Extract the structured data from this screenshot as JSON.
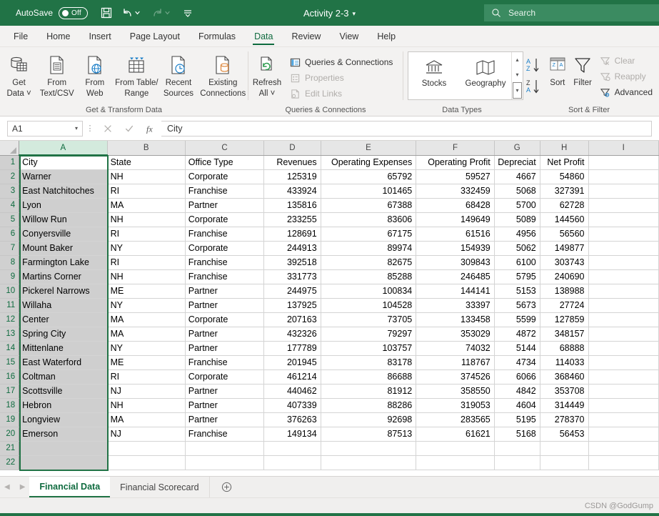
{
  "titlebar": {
    "autosave_label": "AutoSave",
    "autosave_state": "Off",
    "save_icon": "save-icon",
    "undo_icon": "undo-icon",
    "redo_icon": "redo-icon",
    "customize_icon": "customize-quick-access-icon",
    "document_title": "Activity 2-3",
    "title_caret": "▾",
    "search_icon": "search-icon",
    "search_placeholder": "Search",
    "bg_color": "#217346"
  },
  "ribbon_tabs": [
    {
      "label": "File",
      "active": false
    },
    {
      "label": "Home",
      "active": false
    },
    {
      "label": "Insert",
      "active": false
    },
    {
      "label": "Page Layout",
      "active": false
    },
    {
      "label": "Formulas",
      "active": false
    },
    {
      "label": "Data",
      "active": true
    },
    {
      "label": "Review",
      "active": false
    },
    {
      "label": "View",
      "active": false
    },
    {
      "label": "Help",
      "active": false
    }
  ],
  "ribbon": {
    "groups": [
      {
        "title": "Get & Transform Data",
        "buttons": [
          {
            "label": "Get\nData ˅",
            "line1": "Get",
            "line2": "Data ˅",
            "icon": "get-data-icon"
          },
          {
            "label": "From\nText/CSV",
            "line1": "From",
            "line2": "Text/CSV",
            "icon": "from-text-csv-icon"
          },
          {
            "label": "From\nWeb",
            "line1": "From",
            "line2": "Web",
            "icon": "from-web-icon"
          },
          {
            "label": "From Table/\nRange",
            "line1": "From Table/",
            "line2": "Range",
            "icon": "from-table-range-icon"
          },
          {
            "label": "Recent\nSources",
            "line1": "Recent",
            "line2": "Sources",
            "icon": "recent-sources-icon"
          },
          {
            "label": "Existing\nConnections",
            "line1": "Existing",
            "line2": "Connections",
            "icon": "existing-connections-icon"
          }
        ]
      },
      {
        "title": "Queries & Connections",
        "refresh": {
          "line1": "Refresh",
          "line2": "All ˅",
          "icon": "refresh-all-icon"
        },
        "items": [
          {
            "label": "Queries & Connections",
            "icon": "queries-connections-icon",
            "disabled": false
          },
          {
            "label": "Properties",
            "icon": "properties-icon",
            "disabled": true
          },
          {
            "label": "Edit Links",
            "icon": "edit-links-icon",
            "disabled": true
          }
        ]
      },
      {
        "title": "Data Types",
        "items": [
          {
            "label": "Stocks",
            "icon": "stocks-icon"
          },
          {
            "label": "Geography",
            "icon": "geography-icon"
          }
        ],
        "scroll_up": "▴",
        "scroll_down": "▾",
        "scroll_more": "▾"
      },
      {
        "title": "Sort & Filter",
        "sort_asc_icon": "sort-a-to-z-icon",
        "sort_desc_icon": "sort-z-to-a-icon",
        "sort": {
          "label": "Sort",
          "icon": "sort-icon"
        },
        "filter": {
          "label": "Filter",
          "icon": "filter-icon"
        },
        "items": [
          {
            "label": "Clear",
            "icon": "clear-filter-icon",
            "disabled": true
          },
          {
            "label": "Reapply",
            "icon": "reapply-filter-icon",
            "disabled": true
          },
          {
            "label": "Advanced",
            "icon": "advanced-filter-icon",
            "disabled": false
          }
        ]
      }
    ]
  },
  "formula_bar": {
    "name_box": "A1",
    "name_box_caret": "▾",
    "cancel_icon": "cancel-icon",
    "enter_icon": "confirm-check-icon",
    "function_icon": "insert-function-icon",
    "formula_value": "City"
  },
  "grid": {
    "columns": [
      {
        "letter": "A",
        "width": 124,
        "selected": true
      },
      {
        "letter": "B",
        "width": 112,
        "selected": false
      },
      {
        "letter": "C",
        "width": 112,
        "selected": false
      },
      {
        "letter": "D",
        "width": 80,
        "selected": false
      },
      {
        "letter": "E",
        "width": 134,
        "selected": false
      },
      {
        "letter": "F",
        "width": 110,
        "selected": false
      },
      {
        "letter": "G",
        "width": 64,
        "selected": false
      },
      {
        "letter": "H",
        "width": 68,
        "selected": false
      },
      {
        "letter": "I",
        "width": 92,
        "selected": false
      }
    ],
    "headers": [
      "City",
      "State",
      "Office Type",
      "Revenues",
      "Operating Expenses",
      "Operating Profit",
      "Depreciat",
      "Net Profit",
      ""
    ],
    "rows": [
      {
        "n": 1,
        "cells": [
          "City",
          "State",
          "Office Type",
          "Revenues",
          "Operating Expenses",
          "Operating Profit",
          "Depreciat",
          "Net Profit",
          ""
        ]
      },
      {
        "n": 2,
        "cells": [
          "Warner",
          "NH",
          "Corporate",
          "125319",
          "65792",
          "59527",
          "4667",
          "54860",
          ""
        ]
      },
      {
        "n": 3,
        "cells": [
          "East Natchitoches",
          "RI",
          "Franchise",
          "433924",
          "101465",
          "332459",
          "5068",
          "327391",
          ""
        ]
      },
      {
        "n": 4,
        "cells": [
          "Lyon",
          "MA",
          "Partner",
          "135816",
          "67388",
          "68428",
          "5700",
          "62728",
          ""
        ]
      },
      {
        "n": 5,
        "cells": [
          "Willow Run",
          "NH",
          "Corporate",
          "233255",
          "83606",
          "149649",
          "5089",
          "144560",
          ""
        ]
      },
      {
        "n": 6,
        "cells": [
          "Conyersville",
          "RI",
          "Franchise",
          "128691",
          "67175",
          "61516",
          "4956",
          "56560",
          ""
        ]
      },
      {
        "n": 7,
        "cells": [
          "Mount Baker",
          "NY",
          "Corporate",
          "244913",
          "89974",
          "154939",
          "5062",
          "149877",
          ""
        ]
      },
      {
        "n": 8,
        "cells": [
          "Farmington Lake",
          "RI",
          "Franchise",
          "392518",
          "82675",
          "309843",
          "6100",
          "303743",
          ""
        ]
      },
      {
        "n": 9,
        "cells": [
          "Martins Corner",
          "NH",
          "Franchise",
          "331773",
          "85288",
          "246485",
          "5795",
          "240690",
          ""
        ]
      },
      {
        "n": 10,
        "cells": [
          "Pickerel Narrows",
          "ME",
          "Partner",
          "244975",
          "100834",
          "144141",
          "5153",
          "138988",
          ""
        ]
      },
      {
        "n": 11,
        "cells": [
          "Willaha",
          "NY",
          "Partner",
          "137925",
          "104528",
          "33397",
          "5673",
          "27724",
          ""
        ]
      },
      {
        "n": 12,
        "cells": [
          "Center",
          "MA",
          "Corporate",
          "207163",
          "73705",
          "133458",
          "5599",
          "127859",
          ""
        ]
      },
      {
        "n": 13,
        "cells": [
          "Spring City",
          "MA",
          "Partner",
          "432326",
          "79297",
          "353029",
          "4872",
          "348157",
          ""
        ]
      },
      {
        "n": 14,
        "cells": [
          "Mittenlane",
          "NY",
          "Partner",
          "177789",
          "103757",
          "74032",
          "5144",
          "68888",
          ""
        ]
      },
      {
        "n": 15,
        "cells": [
          "East Waterford",
          "ME",
          "Franchise",
          "201945",
          "83178",
          "118767",
          "4734",
          "114033",
          ""
        ]
      },
      {
        "n": 16,
        "cells": [
          "Coltman",
          "RI",
          "Corporate",
          "461214",
          "86688",
          "374526",
          "6066",
          "368460",
          ""
        ]
      },
      {
        "n": 17,
        "cells": [
          "Scottsville",
          "NJ",
          "Partner",
          "440462",
          "81912",
          "358550",
          "4842",
          "353708",
          ""
        ]
      },
      {
        "n": 18,
        "cells": [
          "Hebron",
          "NH",
          "Partner",
          "407339",
          "88286",
          "319053",
          "4604",
          "314449",
          ""
        ]
      },
      {
        "n": 19,
        "cells": [
          "Longview",
          "MA",
          "Partner",
          "376263",
          "92698",
          "283565",
          "5195",
          "278370",
          ""
        ]
      },
      {
        "n": 20,
        "cells": [
          "Emerson",
          "NJ",
          "Franchise",
          "149134",
          "87513",
          "61621",
          "5168",
          "56453",
          ""
        ]
      },
      {
        "n": 21,
        "cells": [
          "",
          "",
          "",
          "",
          "",
          "",
          "",
          "",
          ""
        ]
      },
      {
        "n": 22,
        "cells": [
          "",
          "",
          "",
          "",
          "",
          "",
          "",
          "",
          ""
        ]
      }
    ],
    "numeric_columns": [
      3,
      4,
      5,
      6,
      7
    ],
    "selected_column_index": 0,
    "active_cell": "A1"
  },
  "sheetbar": {
    "prev_icon": "previous-sheet-icon",
    "next_icon": "next-sheet-icon",
    "tabs": [
      {
        "label": "Financial Data",
        "active": true
      },
      {
        "label": "Financial Scorecard",
        "active": false
      }
    ],
    "add_sheet_icon": "add-sheet-icon"
  },
  "statusbar": {
    "watermark": "CSDN @GodGump"
  }
}
